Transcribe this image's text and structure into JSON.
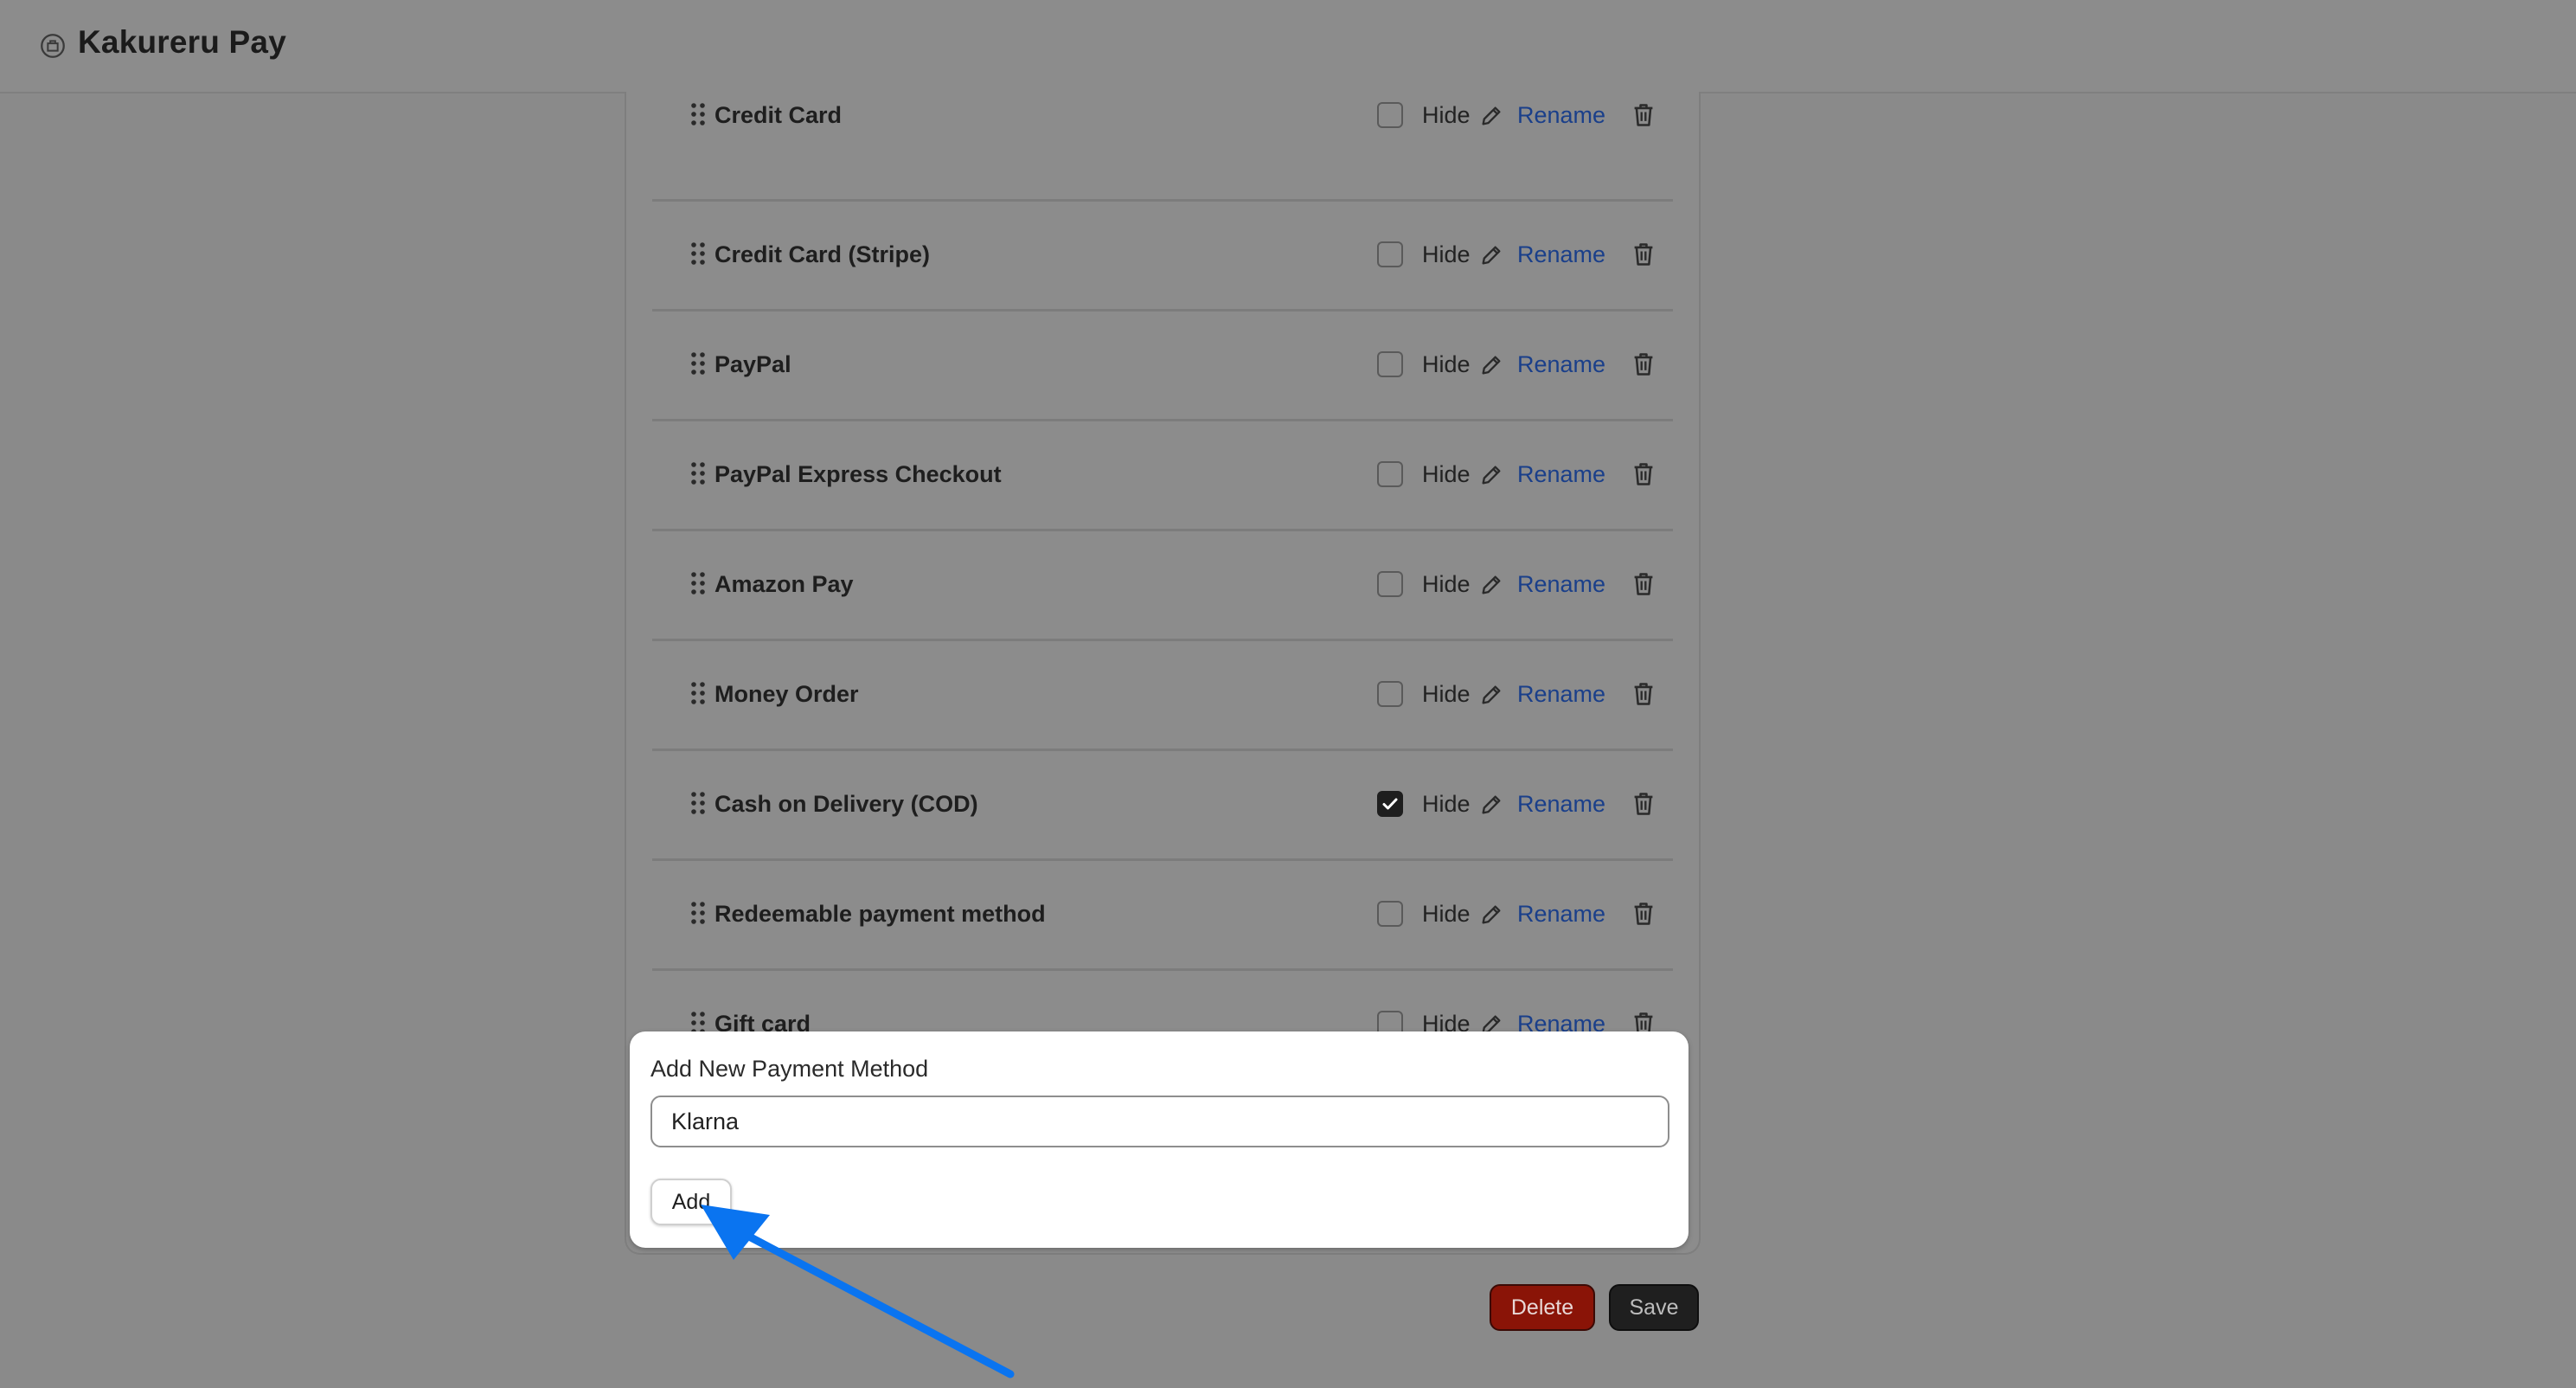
{
  "app": {
    "title": "Kakureru Pay",
    "logo_icon": "wallet-icon"
  },
  "payment_methods": [
    {
      "name": "Credit Card",
      "hidden": false
    },
    {
      "name": "Credit Card (Stripe)",
      "hidden": false
    },
    {
      "name": "PayPal",
      "hidden": false
    },
    {
      "name": "PayPal Express Checkout",
      "hidden": false
    },
    {
      "name": "Amazon Pay",
      "hidden": false
    },
    {
      "name": "Money Order",
      "hidden": false
    },
    {
      "name": "Cash on Delivery (COD)",
      "hidden": true
    },
    {
      "name": "Redeemable payment method",
      "hidden": false
    },
    {
      "name": "Gift card",
      "hidden": false
    }
  ],
  "row_labels": {
    "hide": "Hide",
    "rename": "Rename"
  },
  "add_form": {
    "label": "Add New Payment Method",
    "input_value": "Klarna",
    "button_label": "Add"
  },
  "actions": {
    "delete_label": "Delete",
    "save_label": "Save"
  },
  "colors": {
    "rename_link": "#1a3f8a",
    "delete_button": "#8a1407",
    "save_button": "#1f1f1f",
    "annotation_arrow": "#0a74f0"
  }
}
